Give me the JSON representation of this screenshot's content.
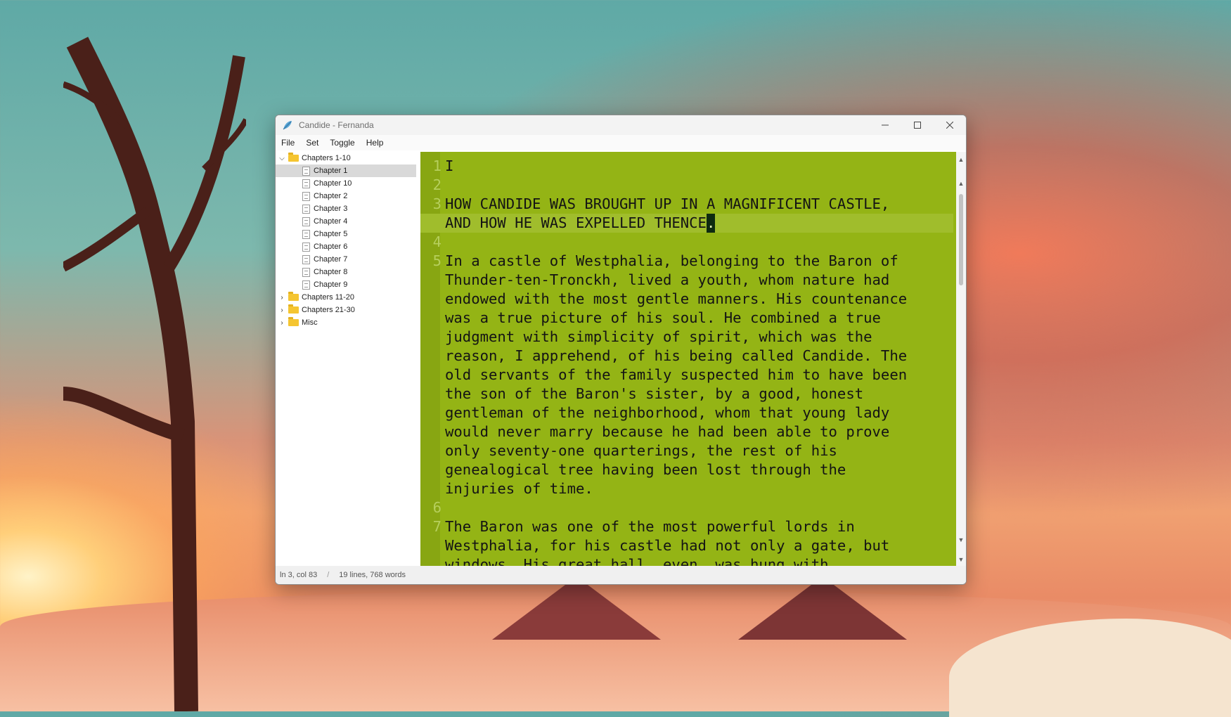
{
  "window": {
    "title": "Candide - Fernanda"
  },
  "menu": [
    "File",
    "Set",
    "Toggle",
    "Help"
  ],
  "tree": [
    {
      "label": "Chapters 1-10",
      "type": "folder",
      "expanded": true
    },
    {
      "label": "Chapter 1",
      "type": "doc",
      "selected": true
    },
    {
      "label": "Chapter 10",
      "type": "doc"
    },
    {
      "label": "Chapter 2",
      "type": "doc"
    },
    {
      "label": "Chapter 3",
      "type": "doc"
    },
    {
      "label": "Chapter 4",
      "type": "doc"
    },
    {
      "label": "Chapter 5",
      "type": "doc"
    },
    {
      "label": "Chapter 6",
      "type": "doc"
    },
    {
      "label": "Chapter 7",
      "type": "doc"
    },
    {
      "label": "Chapter 8",
      "type": "doc"
    },
    {
      "label": "Chapter 9",
      "type": "doc"
    },
    {
      "label": "Chapters 11-20",
      "type": "folder",
      "expanded": false
    },
    {
      "label": "Chapters 21-30",
      "type": "folder",
      "expanded": false
    },
    {
      "label": "Misc",
      "type": "folder",
      "expanded": false
    }
  ],
  "editor": {
    "lines": [
      {
        "num": "1",
        "text": "I"
      },
      {
        "num": "2",
        "text": ""
      },
      {
        "num": "3",
        "text": "HOW CANDIDE WAS BROUGHT UP IN A MAGNIFICENT CASTLE,"
      },
      {
        "num": "",
        "text": "AND HOW HE WAS EXPELLED THENCE",
        "cursor": ".",
        "current": true
      },
      {
        "num": "4",
        "text": ""
      },
      {
        "num": "5",
        "text": "In a castle of Westphalia, belonging to the Baron of"
      },
      {
        "num": "",
        "text": "Thunder-ten-Tronckh, lived a youth, whom nature had"
      },
      {
        "num": "",
        "text": "endowed with the most gentle manners. His countenance"
      },
      {
        "num": "",
        "text": "was a true picture of his soul. He combined a true"
      },
      {
        "num": "",
        "text": "judgment with simplicity of spirit, which was the"
      },
      {
        "num": "",
        "text": "reason, I apprehend, of his being called Candide. The"
      },
      {
        "num": "",
        "text": "old servants of the family suspected him to have been"
      },
      {
        "num": "",
        "text": "the son of the Baron's sister, by a good, honest"
      },
      {
        "num": "",
        "text": "gentleman of the neighborhood, whom that young lady"
      },
      {
        "num": "",
        "text": "would never marry because he had been able to prove"
      },
      {
        "num": "",
        "text": "only seventy-one quarterings, the rest of his"
      },
      {
        "num": "",
        "text": "genealogical tree having been lost through the"
      },
      {
        "num": "",
        "text": "injuries of time."
      },
      {
        "num": "6",
        "text": ""
      },
      {
        "num": "7",
        "text": "The Baron was one of the most powerful lords in"
      },
      {
        "num": "",
        "text": "Westphalia, for his castle had not only a gate, but"
      },
      {
        "num": "",
        "text": "windows. His great hall, even, was hung with"
      }
    ]
  },
  "status": {
    "position": "ln 3, col 83",
    "separator": "/",
    "counts": "19 lines, 768 words"
  },
  "colors": {
    "editor_bg": "#94b415",
    "selected_row": "#d9d9d9",
    "folder": "#f5c531"
  }
}
